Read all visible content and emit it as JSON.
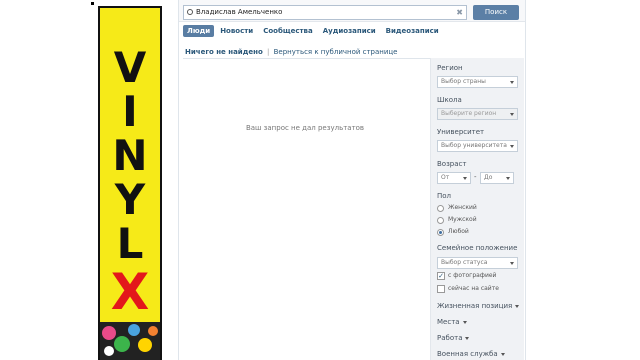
{
  "search": {
    "query": "Владислав Амельченко",
    "button_label": "Поиск"
  },
  "tabs": [
    {
      "label": "Люди",
      "active": true
    },
    {
      "label": "Новости"
    },
    {
      "label": "Сообщества"
    },
    {
      "label": "Аудиозаписи"
    },
    {
      "label": "Видеозаписи"
    }
  ],
  "summary": {
    "status": "Ничего не найдено",
    "separator": "|",
    "back_link": "Вернуться к публичной странице"
  },
  "empty_message": "Ваш запрос не дал результатов",
  "banner": {
    "letters": [
      "V",
      "I",
      "N",
      "Y",
      "L",
      "X"
    ]
  },
  "filters": {
    "region_label": "Регион",
    "region_placeholder": "Выбор страны",
    "school_label": "Школа",
    "school_placeholder": "Выберите регион",
    "university_label": "Университет",
    "university_placeholder": "Выбор университета",
    "age_label": "Возраст",
    "age_from": "От",
    "age_dash": "-",
    "age_to": "До",
    "sex_label": "Пол",
    "sex_options": [
      "Женский",
      "Мужской",
      "Любой"
    ],
    "sex_selected": "Любой",
    "marital_label": "Семейное положение",
    "marital_placeholder": "Выбор статуса",
    "with_photo": "с фотографией",
    "with_photo_checked": true,
    "online": "сейчас на сайте",
    "online_checked": false,
    "life_position": "Жизненная позиция",
    "places": "Места",
    "work": "Работа",
    "military": "Военная служба"
  },
  "colors": {
    "accent": "#5b7fa6",
    "link": "#2b587a",
    "banner_yellow": "#f6ea18",
    "banner_red": "#e3171b"
  }
}
